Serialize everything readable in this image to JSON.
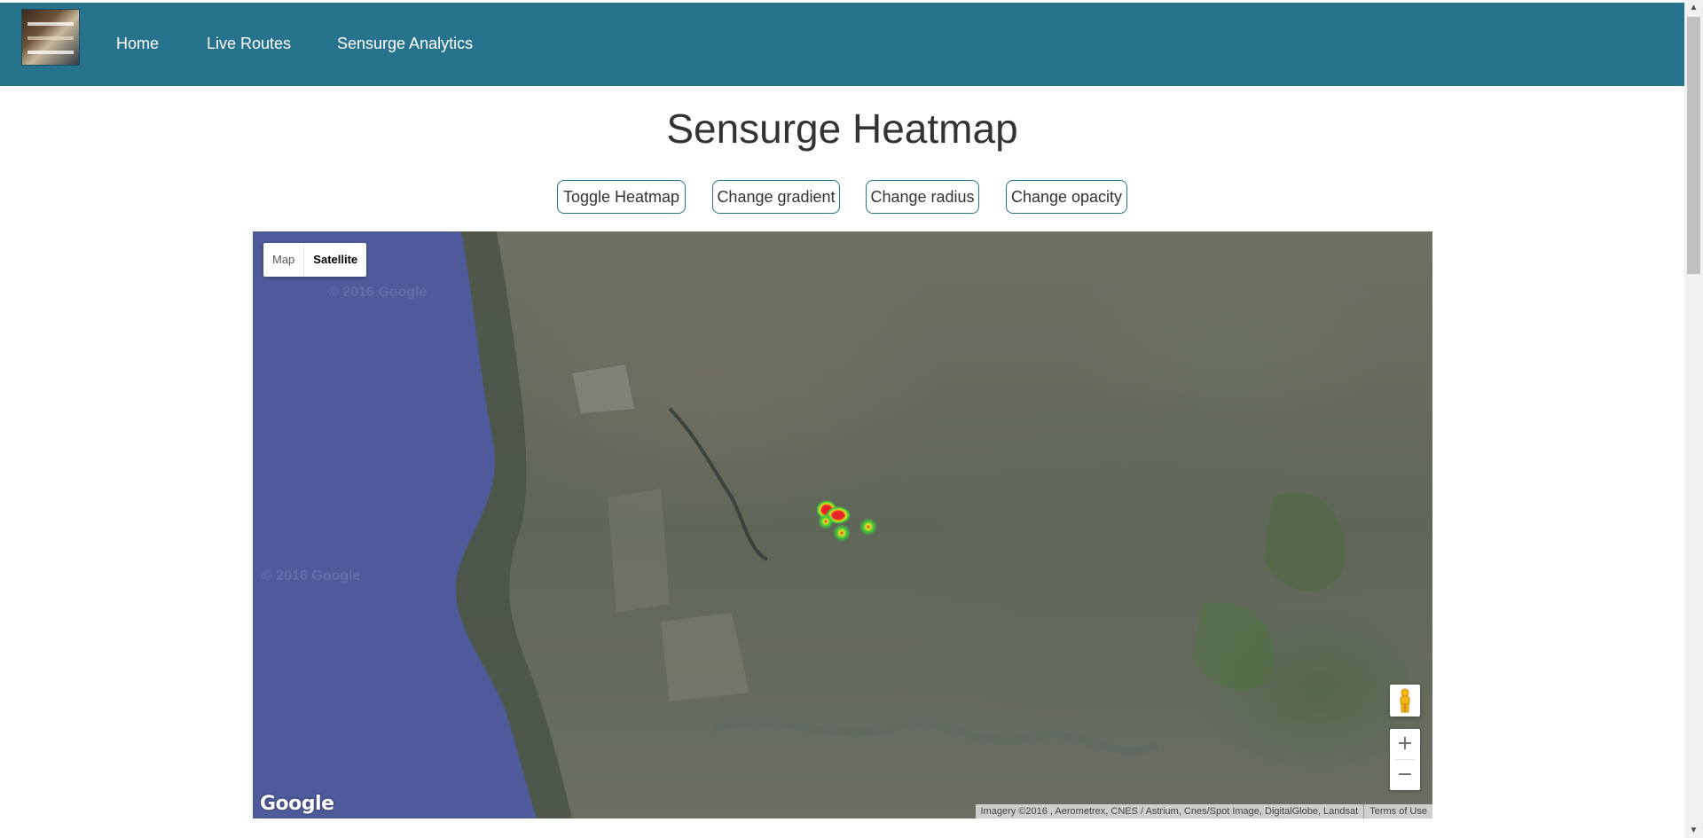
{
  "nav": {
    "links": [
      {
        "label": "Home"
      },
      {
        "label": "Live Routes"
      },
      {
        "label": "Sensurge Analytics"
      }
    ]
  },
  "page": {
    "title": "Sensurge Heatmap"
  },
  "controls": {
    "toggle_heatmap": "Toggle Heatmap",
    "change_gradient": "Change gradient",
    "change_radius": "Change radius",
    "change_opacity": "Change opacity"
  },
  "map": {
    "type_options": [
      "Map",
      "Satellite"
    ],
    "selected_type": "Satellite",
    "watermark": "© 2016 Google",
    "zoom_in": "+",
    "zoom_out": "−",
    "logo": "Google",
    "attribution": "Imagery ©2016 , Aerometrex, CNES / Astrium, Cnes/Spot Image, DigitalGlobe, Landsat",
    "terms": "Terms of Use",
    "colors": {
      "sea": "#4e5a9a",
      "heat_hot": "#e8232a",
      "heat_mid": "#e0e020",
      "heat_cool": "#3cc43c"
    }
  },
  "scrollbar": {
    "up_icon": "▲",
    "down_icon": "▼"
  }
}
